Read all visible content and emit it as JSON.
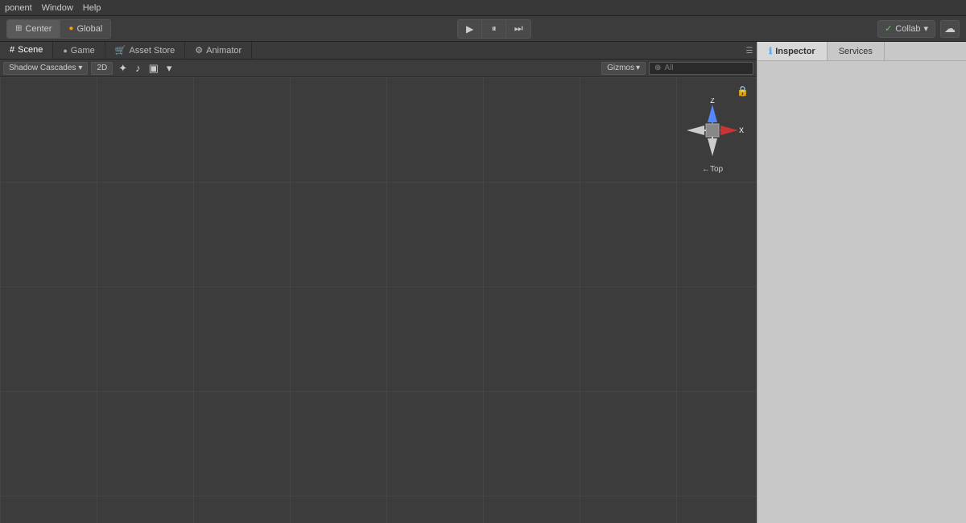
{
  "menubar": {
    "items": [
      "ponent",
      "Window",
      "Help"
    ]
  },
  "toolbar": {
    "center_label": "Center",
    "global_label": "Global",
    "play_button": "▶",
    "pause_button": "⏸",
    "step_button": "⏭",
    "collab_label": "Collab",
    "cloud_icon": "☁",
    "collab_check": "✓"
  },
  "tabs": [
    {
      "id": "scene",
      "icon": "⊞",
      "label": "Scene",
      "active": true
    },
    {
      "id": "game",
      "icon": "●",
      "label": "Game",
      "active": false
    },
    {
      "id": "asset-store",
      "icon": "🛒",
      "label": "Asset Store",
      "active": false
    },
    {
      "id": "animator",
      "icon": "⚙",
      "label": "Animator",
      "active": false
    }
  ],
  "scene_toolbar": {
    "shadow_cascades": "Shadow Cascades",
    "two_d": "2D",
    "gizmos": "Gizmos",
    "search_placeholder": "⊕All",
    "search_value": ""
  },
  "gizmo": {
    "axis_label": "←Top"
  },
  "right_panel": {
    "tabs": [
      {
        "id": "inspector",
        "icon": "ℹ",
        "label": "Inspector",
        "active": true
      },
      {
        "id": "services",
        "label": "Services",
        "active": false
      }
    ]
  }
}
